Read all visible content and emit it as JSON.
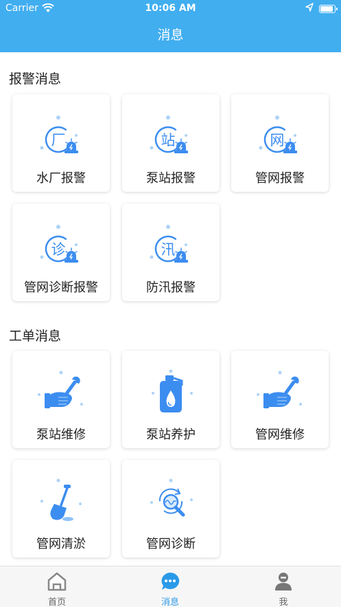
{
  "status_bar": {
    "carrier": "Carrier",
    "time": "10:06 AM"
  },
  "nav": {
    "title": "消息"
  },
  "alarm_section": {
    "title": "报警消息",
    "items": [
      {
        "label": "水厂报警",
        "glyph": "厂",
        "icon": "factory-alarm-icon"
      },
      {
        "label": "泵站报警",
        "glyph": "站",
        "icon": "pump-station-alarm-icon"
      },
      {
        "label": "管网报警",
        "glyph": "网",
        "icon": "pipe-network-alarm-icon"
      },
      {
        "label": "管网诊断报警",
        "glyph": "诊",
        "icon": "diagnosis-alarm-icon"
      },
      {
        "label": "防汛报警",
        "glyph": "汛",
        "icon": "flood-alarm-icon"
      }
    ]
  },
  "work_section": {
    "title": "工单消息",
    "items": [
      {
        "label": "泵站维修",
        "icon": "wrench-hand-icon"
      },
      {
        "label": "泵站养护",
        "icon": "oil-can-icon"
      },
      {
        "label": "管网维修",
        "icon": "wrench-hand-icon"
      },
      {
        "label": "管网清淤",
        "icon": "shovel-icon"
      },
      {
        "label": "管网诊断",
        "icon": "magnifier-wave-icon"
      }
    ]
  },
  "tabs": [
    {
      "label": "首页",
      "icon": "home-icon",
      "active": false
    },
    {
      "label": "消息",
      "icon": "message-bubble-icon",
      "active": true
    },
    {
      "label": "我",
      "icon": "user-icon",
      "active": false
    }
  ],
  "colors": {
    "brand": "#41aef0",
    "icon_blue": "#3c8df0",
    "tab_active": "#2a9ae8"
  }
}
